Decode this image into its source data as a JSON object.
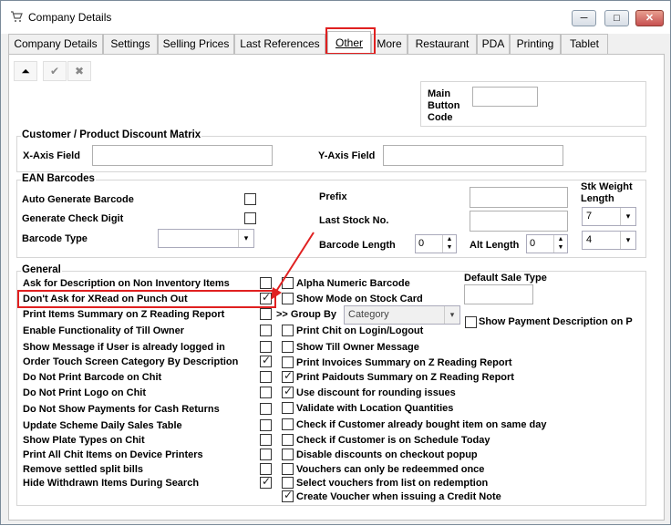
{
  "window": {
    "title": "Company Details",
    "min": "─",
    "max": "□",
    "close": "✕"
  },
  "tabs": [
    "Company Details",
    "Settings",
    "Selling Prices",
    "Last References",
    "Other",
    "More",
    "Restaurant",
    "PDA",
    "Printing",
    "Tablet"
  ],
  "active_tab": "Other",
  "toolbar": {
    "collapse": "⏶",
    "ok": "✔",
    "cancel": "✖"
  },
  "main_button_code": {
    "label_line1": "Main",
    "label_line2": "Button",
    "label_line3": "Code",
    "value": ""
  },
  "discount_matrix": {
    "title": "Customer / Product Discount Matrix",
    "x_label": "X-Axis Field",
    "x_value": "",
    "y_label": "Y-Axis Field",
    "y_value": ""
  },
  "ean": {
    "title": "EAN Barcodes",
    "auto_generate": "Auto Generate Barcode",
    "check_digit": "Generate Check Digit",
    "barcode_type": "Barcode Type",
    "barcode_type_value": "",
    "prefix": "Prefix",
    "prefix_value": "",
    "last_stock": "Last Stock No.",
    "last_stock_value": "",
    "barcode_length": "Barcode Length",
    "barcode_length_value": "0",
    "alt_length": "Alt Length",
    "alt_length_value": "0",
    "stk_weight_line1": "Stk Weight",
    "stk_weight_line2": "Length",
    "stk_weight_value1": "7",
    "stk_weight_value2": "4"
  },
  "general": {
    "title": "General",
    "left": [
      {
        "label": "Ask for Description on Non Inventory Items",
        "checked": false
      },
      {
        "label": "Don't Ask for XRead on Punch Out",
        "checked": true
      },
      {
        "label": "Print Items Summary on Z Reading Report",
        "checked": false
      },
      {
        "label": "Enable Functionality of Till Owner",
        "checked": false
      },
      {
        "label": "Show Message if User is already logged in",
        "checked": false
      },
      {
        "label": "Order Touch Screen Category By Description",
        "checked": true
      },
      {
        "label": "Do Not Print Barcode on Chit",
        "checked": false
      },
      {
        "label": "Do Not Print Logo on Chit",
        "checked": false
      },
      {
        "label": "Do Not Show Payments for Cash Returns",
        "checked": false
      },
      {
        "label": "Update Scheme Daily Sales Table",
        "checked": false
      },
      {
        "label": "Show Plate Types on Chit",
        "checked": false
      },
      {
        "label": "Print All Chit Items on Device Printers",
        "checked": false
      },
      {
        "label": "Remove settled split bills",
        "checked": false
      },
      {
        "label": "Hide Withdrawn Items During Search",
        "checked": true
      }
    ],
    "right": [
      {
        "label": "Alpha Numeric Barcode",
        "checked": false
      },
      {
        "label": "Show Mode on Stock Card",
        "checked": false
      },
      {
        "label": "Print Chit on Login/Logout",
        "checked": false
      },
      {
        "label": "Show Till Owner Message",
        "checked": false
      },
      {
        "label": "Print Invoices Summary on Z Reading Report",
        "checked": false
      },
      {
        "label": "Print Paidouts Summary on Z Reading Report",
        "checked": true
      },
      {
        "label": "Use discount for rounding issues",
        "checked": true
      },
      {
        "label": "Validate with Location Quantities",
        "checked": false
      },
      {
        "label": "Check if Customer already bought item on same day",
        "checked": false
      },
      {
        "label": "Check if Customer is on Schedule Today",
        "checked": false
      },
      {
        "label": "Disable discounts on checkout popup",
        "checked": false
      },
      {
        "label": "Vouchers can only be redeemmed once",
        "checked": false
      },
      {
        "label": "Select vouchers from list on redemption",
        "checked": false
      },
      {
        "label": "Create Voucher when issuing a Credit Note",
        "checked": true
      }
    ],
    "group_by_label": ">> Group By",
    "group_by_value": "Category",
    "default_sale_type": "Default Sale Type",
    "default_sale_type_value": "",
    "show_payment_desc": "Show Payment Description on P",
    "show_payment_desc_checked": false
  },
  "colors": {
    "highlight": "#e02020"
  }
}
